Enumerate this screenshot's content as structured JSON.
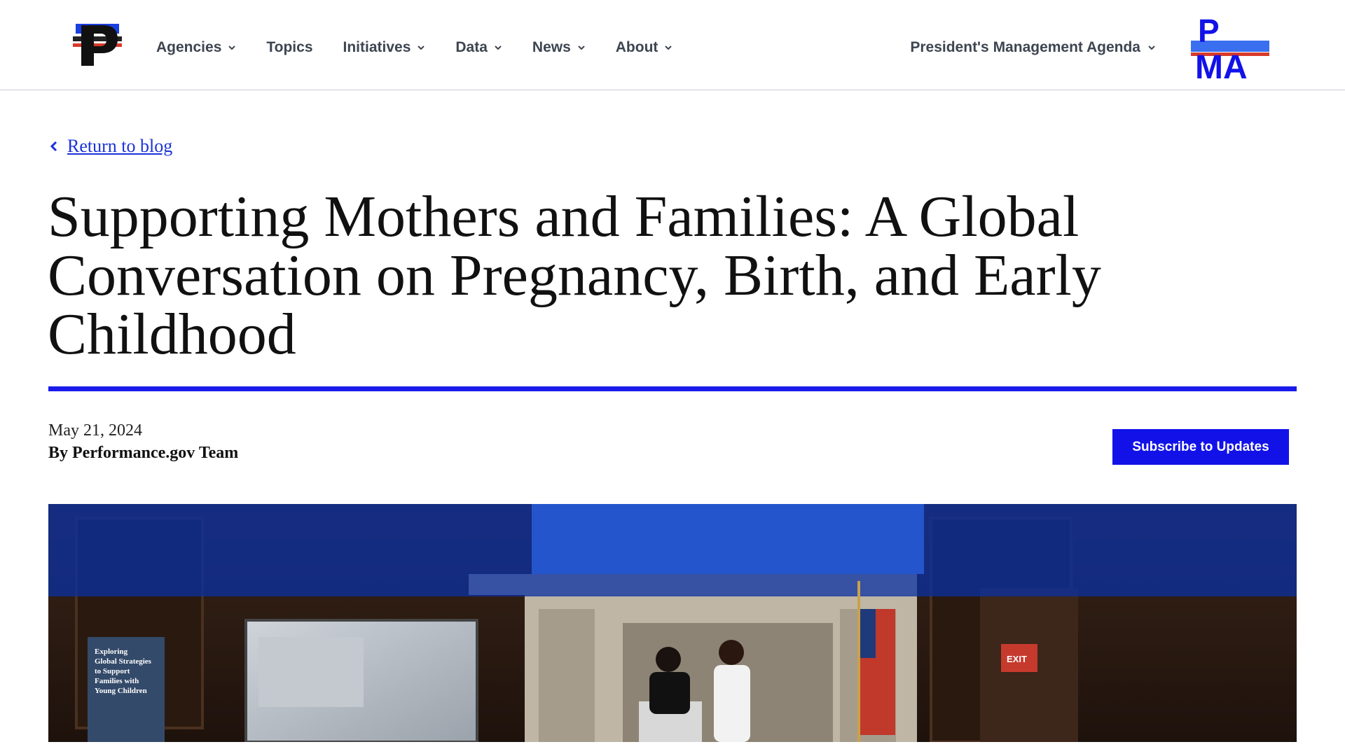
{
  "header": {
    "logo_icon": "performance-gov-p-logo",
    "nav": [
      {
        "label": "Agencies",
        "has_dropdown": true
      },
      {
        "label": "Topics",
        "has_dropdown": false
      },
      {
        "label": "Initiatives",
        "has_dropdown": true
      },
      {
        "label": "Data",
        "has_dropdown": true
      },
      {
        "label": "News",
        "has_dropdown": true
      },
      {
        "label": "About",
        "has_dropdown": true
      }
    ],
    "pma_link": "President's Management Agenda",
    "pma_logo": {
      "top": "P",
      "bottom": "MA"
    }
  },
  "article": {
    "return_link": "Return to blog",
    "title": "Supporting Mothers and Families: A Global Conversation on Pregnancy, Birth, and Early Childhood",
    "date": "May 21, 2024",
    "byline": "By Performance.gov Team",
    "subscribe_label": "Subscribe to Updates",
    "hero_banner_text": "Exploring Global Strategies to Support Families with Young Children"
  },
  "colors": {
    "brand_blue": "#1212e8",
    "link_blue": "#1a32d8",
    "nav_text": "#3d4551",
    "accent_red": "#d83a2b"
  }
}
